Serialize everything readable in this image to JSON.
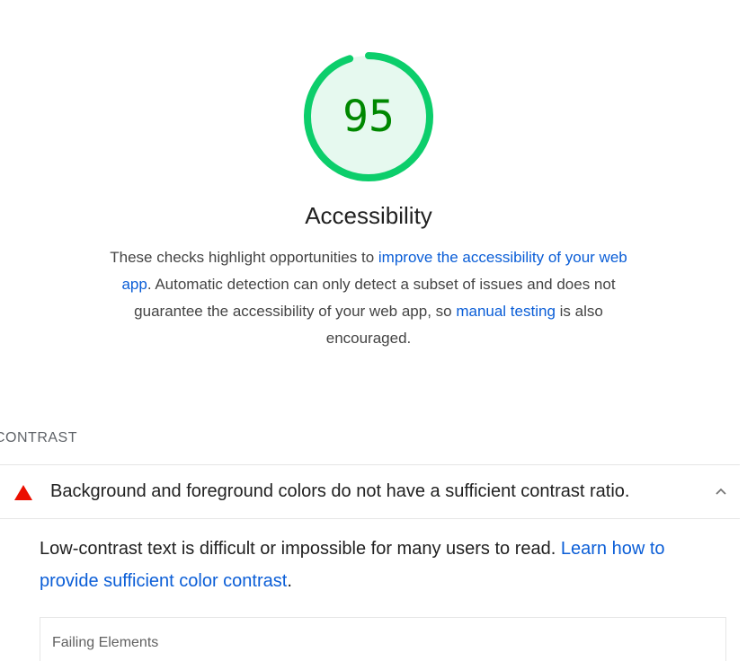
{
  "gauge": {
    "score": "95",
    "fraction": 0.95,
    "color": "#0cce6b",
    "fill_color": "#e6f9ef",
    "text_color": "#008800"
  },
  "category": {
    "title": "Accessibility",
    "description": {
      "part1": "These checks highlight opportunities to ",
      "link1": "improve the accessibility of your web app",
      "part2": ". Automatic detection can only detect a subset of issues and does not guarantee the accessibility of your web app, so ",
      "link2": "manual testing",
      "part3": " is also encouraged."
    }
  },
  "group": {
    "title": "CONTRAST"
  },
  "audit": {
    "status_icon": "fail-triangle-icon",
    "status_color": "#eb0f00",
    "title": "Background and foreground colors do not have a sufficient contrast ratio.",
    "expanded": true,
    "description": {
      "part1": "Low-contrast text is difficult or impossible for many users to read. ",
      "link": "Learn how to provide sufficient color contrast",
      "part2": "."
    },
    "details": {
      "header": "Failing Elements"
    }
  }
}
